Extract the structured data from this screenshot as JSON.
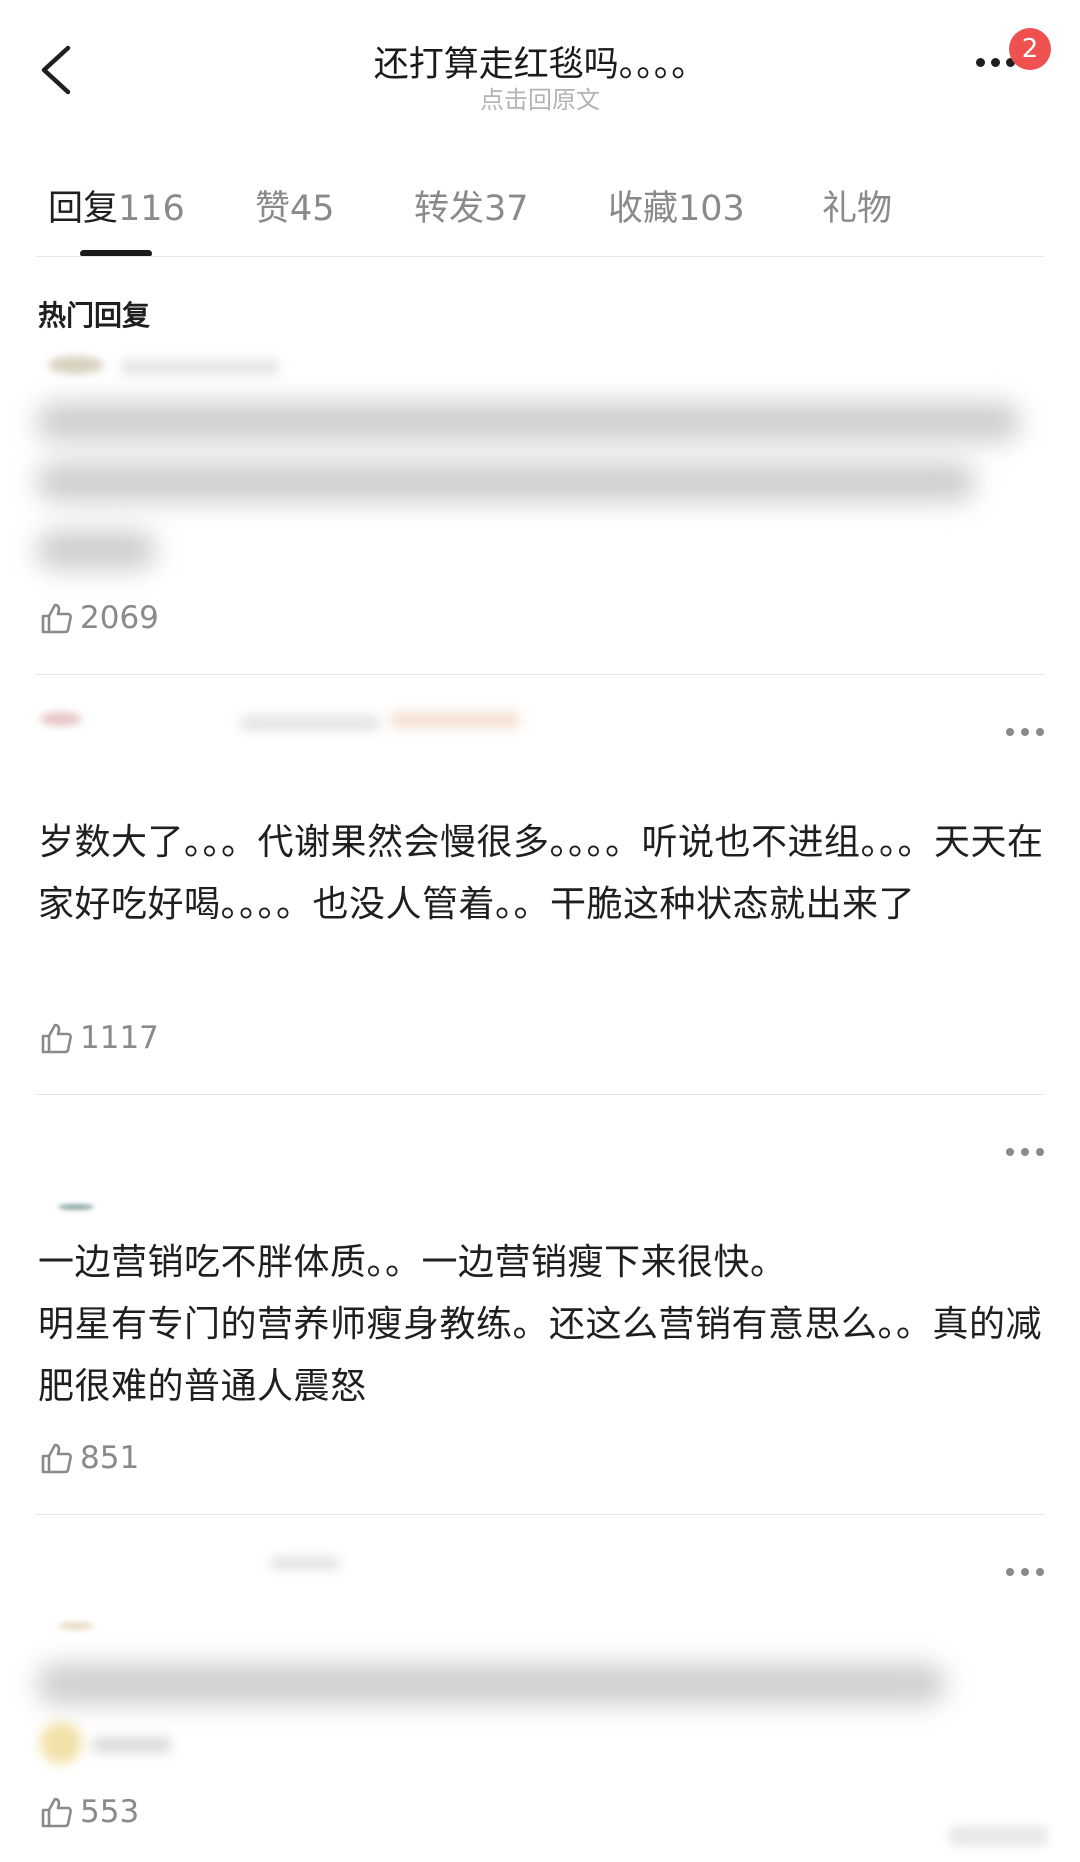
{
  "header": {
    "title": "还打算走红毯吗。。。。",
    "subtitle": "点击回原文",
    "notification_count": "2",
    "icons": {
      "back": "chevron-left-icon",
      "more": "more-horizontal-icon"
    }
  },
  "tabs": [
    {
      "label": "回复",
      "count": "116",
      "active": true
    },
    {
      "label": "赞",
      "count": "45",
      "active": false
    },
    {
      "label": "转发",
      "count": "37",
      "active": false
    },
    {
      "label": "收藏",
      "count": "103",
      "active": false
    },
    {
      "label": "礼物",
      "count": "",
      "active": false
    }
  ],
  "section_title": "热门回复",
  "comments": [
    {
      "text": "",
      "likes": "2069",
      "blurred": true
    },
    {
      "text": "岁数大了。。。代谢果然会慢很多。。。。听说也不进组。。。天天在家好吃好喝。。。。也没人管着。。干脆这种状态就出来了",
      "likes": "1117",
      "blurred": false
    },
    {
      "text": "一边营销吃不胖体质。。一边营销瘦下来很快。\n明星有专门的营养师瘦身教练。还这么营销有意思么。。真的减肥很难的普通人震怒",
      "likes": "851",
      "blurred": false
    },
    {
      "text": "",
      "likes": "553",
      "blurred": true
    }
  ],
  "colors": {
    "badge": "#ef5050",
    "text": "#1f1f1f",
    "muted": "#8a8a8a",
    "divider": "#e6e6e6"
  }
}
